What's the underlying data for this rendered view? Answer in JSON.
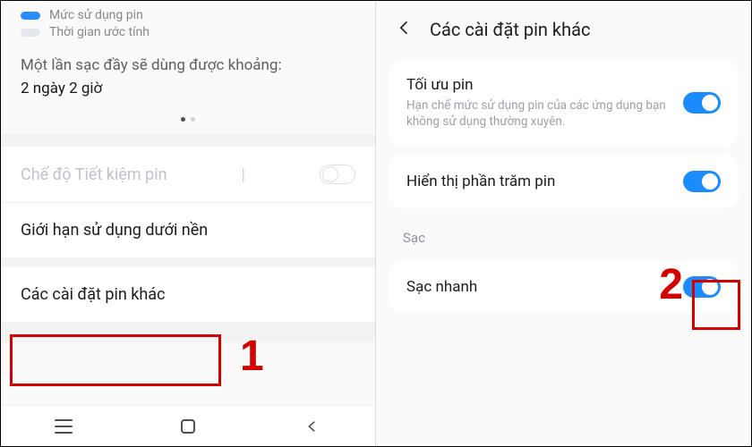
{
  "left": {
    "legend": {
      "usage": "Mức sử dụng pin",
      "estimate": "Thời gian ước tính"
    },
    "estimate": {
      "prefix": "Một lần sạc đầy sẽ dùng được khoảng:",
      "value": "2 ngày 2 giờ"
    },
    "rows": {
      "power_saving": "Chế độ Tiết kiệm pin",
      "background_limit": "Giới hạn sử dụng dưới nền",
      "more_settings": "Các cài đặt pin khác"
    }
  },
  "right": {
    "header_title": "Các cài đặt pin khác",
    "optimize": {
      "title": "Tối ưu pin",
      "subtitle": "Hạn chế mức sử dụng pin của các ứng dụng bạn không sử dụng thường xuyên."
    },
    "show_percent": "Hiển thị phần trăm pin",
    "category_charging": "Sạc",
    "fast_charging": "Sạc nhanh"
  },
  "annotations": {
    "n1": "1",
    "n2": "2"
  }
}
